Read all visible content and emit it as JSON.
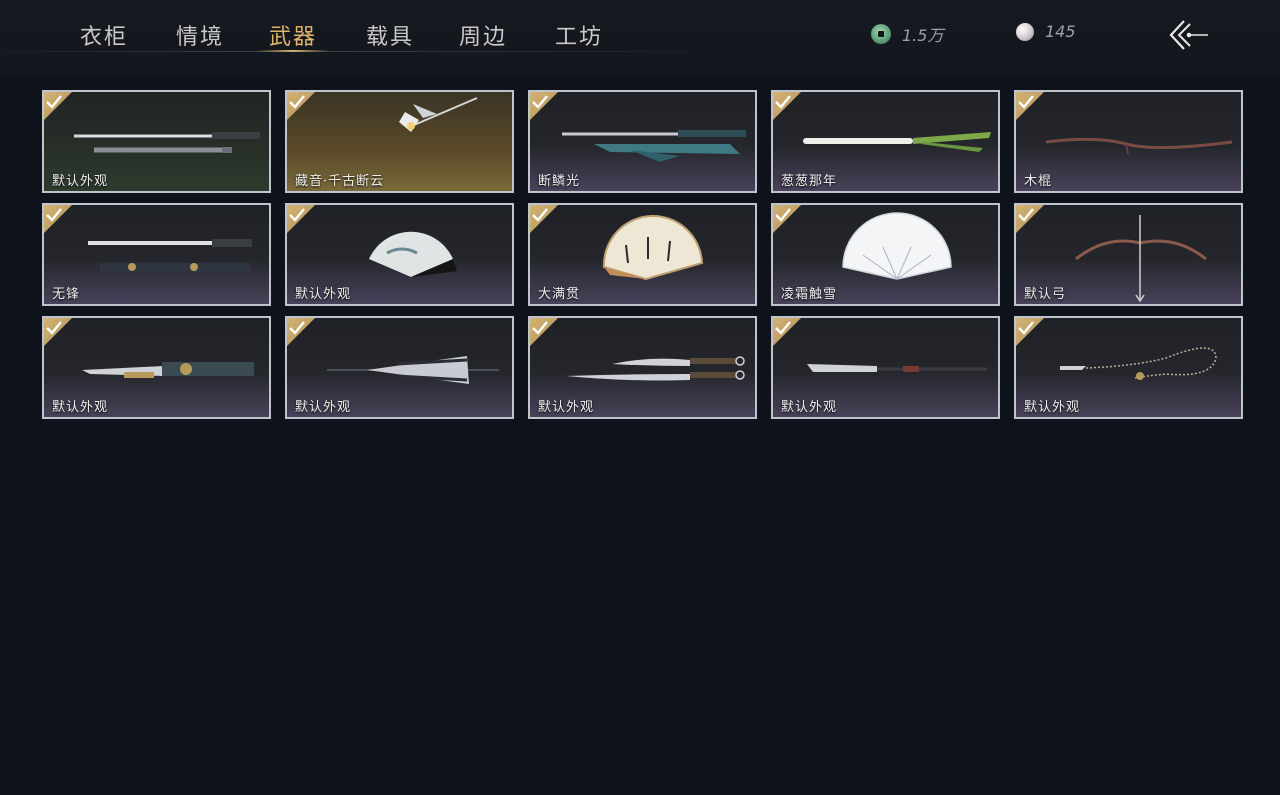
{
  "tabs": [
    {
      "label": "衣柜",
      "active": false
    },
    {
      "label": "情境",
      "active": false
    },
    {
      "label": "武器",
      "active": true
    },
    {
      "label": "载具",
      "active": false
    },
    {
      "label": "周边",
      "active": false
    },
    {
      "label": "工坊",
      "active": false
    }
  ],
  "currency": {
    "coins": {
      "icon": "jade-coin-icon",
      "value": "1.5万"
    },
    "pearls": {
      "icon": "pearl-icon",
      "value": "145"
    }
  },
  "back": {
    "icon": "back-arrow-icon"
  },
  "accent_color": "#e0b36a",
  "items": [
    {
      "label": "默认外观",
      "owned": true,
      "art": "straight-sword"
    },
    {
      "label": "藏音·千古断云",
      "owned": true,
      "art": "ornate-spear"
    },
    {
      "label": "断鳞光",
      "owned": true,
      "art": "jade-sword"
    },
    {
      "label": "葱葱那年",
      "owned": true,
      "art": "green-onion"
    },
    {
      "label": "木棍",
      "owned": true,
      "art": "wooden-stick"
    },
    {
      "label": "无锋",
      "owned": true,
      "art": "blunt-sword"
    },
    {
      "label": "默认外观",
      "owned": true,
      "art": "folding-fan"
    },
    {
      "label": "大满贯",
      "owned": true,
      "art": "calligraphy-fan"
    },
    {
      "label": "凌霜触雪",
      "owned": true,
      "art": "white-fan"
    },
    {
      "label": "默认弓",
      "owned": true,
      "art": "bow"
    },
    {
      "label": "默认外观",
      "owned": true,
      "art": "mechanical-blade"
    },
    {
      "label": "默认外观",
      "owned": true,
      "art": "umbrella"
    },
    {
      "label": "默认外观",
      "owned": true,
      "art": "twin-sabres"
    },
    {
      "label": "默认外观",
      "owned": true,
      "art": "long-spear"
    },
    {
      "label": "默认外观",
      "owned": true,
      "art": "rope-dart"
    }
  ]
}
